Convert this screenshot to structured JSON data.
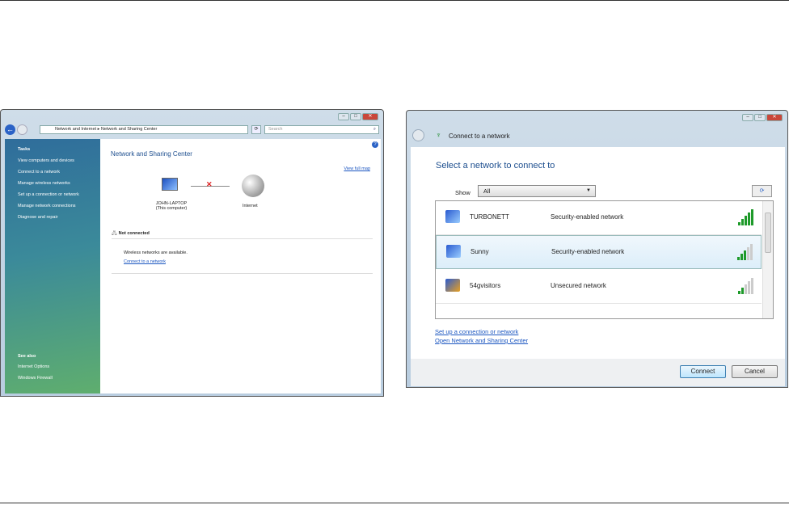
{
  "left_window": {
    "breadcrumb": [
      "Network and Internet",
      "Network and Sharing Center"
    ],
    "search_placeholder": "Search",
    "sidebar": {
      "tasks_title": "Tasks",
      "tasks": [
        "View computers and devices",
        "Connect to a network",
        "Manage wireless networks",
        "Set up a connection or network",
        "Manage network connections",
        "Diagnose and repair"
      ],
      "see_also_title": "See also",
      "see_also": [
        "Internet Options",
        "Windows Firewall"
      ]
    },
    "title": "Network and Sharing Center",
    "view_full_map": "View full map",
    "computer_name": "JOHN-LAPTOP",
    "computer_sub": "(This computer)",
    "internet_label": "Internet",
    "status": "Not connected",
    "wireless_msg": "Wireless networks are available.",
    "connect_link": "Connect to a network"
  },
  "right_window": {
    "title": "Connect to a network",
    "heading": "Select a network to connect to",
    "show_label": "Show",
    "show_value": "All",
    "networks": [
      {
        "name": "TURBONETT",
        "security": "Security-enabled network",
        "signal": 5
      },
      {
        "name": "Sunny",
        "security": "Security-enabled network",
        "signal": 3
      },
      {
        "name": "54gvisitors",
        "security": "Unsecured network",
        "signal": 2
      }
    ],
    "links": [
      "Set up a connection or network",
      "Open Network and Sharing Center"
    ],
    "connect_button": "Connect",
    "cancel_button": "Cancel"
  }
}
